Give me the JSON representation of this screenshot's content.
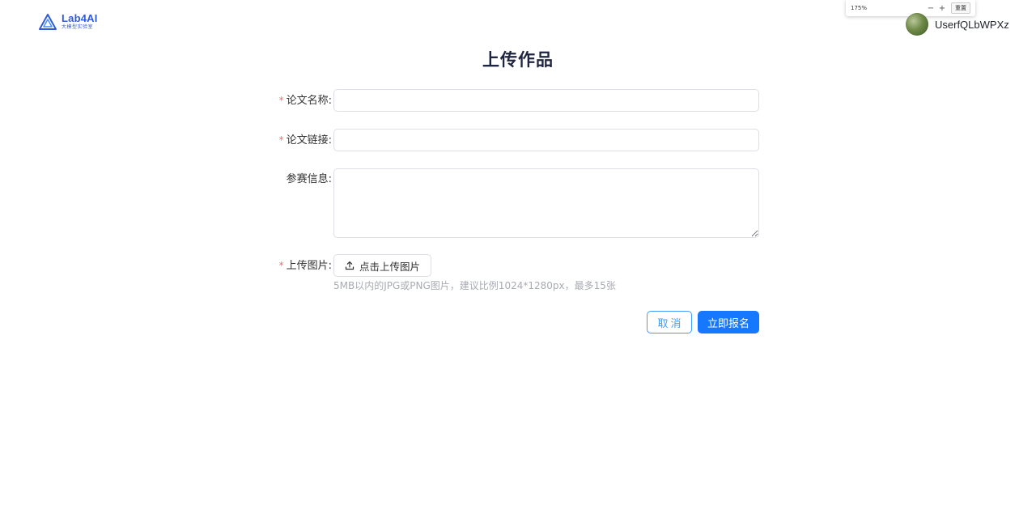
{
  "header": {
    "logo_title": "Lab4AI",
    "logo_subtitle": "大模型实验室",
    "username": "UserfQLbWPXz"
  },
  "zoom_popup": {
    "level": "175%",
    "minus": "−",
    "plus": "+",
    "reset_label": "重置"
  },
  "page": {
    "title": "上传作品"
  },
  "form": {
    "required_mark": "*",
    "paper_name_label": "论文名称:",
    "paper_name_value": "",
    "paper_link_label": "论文链接:",
    "paper_link_value": "",
    "entry_info_label": "参赛信息:",
    "entry_info_value": "",
    "image_label": "上传图片:",
    "upload_button_label": "点击上传图片",
    "upload_hint": "5MB以内的JPG或PNG图片，建议比例1024*1280px，最多15张"
  },
  "actions": {
    "cancel_label": "取消",
    "submit_label": "立即报名"
  },
  "colors": {
    "primary": "#1677ff",
    "cancel_border": "#409eff",
    "required": "#f56c6c",
    "logo": "#2f5bd8"
  }
}
